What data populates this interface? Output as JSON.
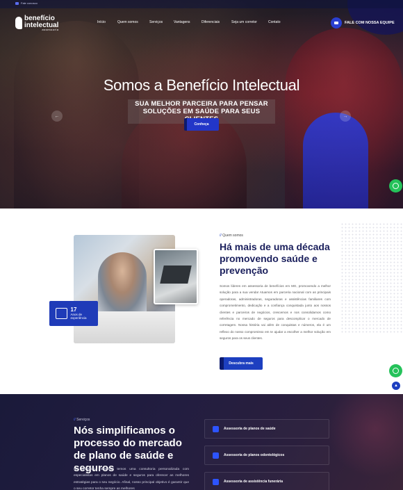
{
  "topbar": {
    "phone_label": "Fale conosco"
  },
  "logo": {
    "line1": "benefício",
    "line2": "intelectual",
    "line3": "assessoria"
  },
  "nav": {
    "items": [
      "Início",
      "Quem somos",
      "Serviços",
      "Vantagens",
      "Diferenciais",
      "Seja um corretor",
      "Contato"
    ],
    "cta": "FALE COM NOSSA EQUIPE"
  },
  "hero": {
    "title": "Somos a Benefício Intelectual",
    "subtitle": "SUA MELHOR PARCEIRA PARA PENSAR SOLUÇÕES EM SAÚDE PARA SEUS CLIENTES",
    "button": "Conheça",
    "prev": "←",
    "next": "→"
  },
  "about": {
    "eyebrow_slash": "//",
    "eyebrow": "Quem somos",
    "title": "Há mais de uma década promovendo saúde e prevenção",
    "text": "Somos líderes em assessoria de benefícios em MG, promovendo a melhor solução para a sua venda! Atuamos em parceria nacional com as principais operadoras, administradoras, seguradoras e assistências familiares com comprometimento, dedicação e a confiança conquistada junto aos nossos clientes e parceiros de negócios, crescemos e nos consolidamos como referência no mercado de seguros para descomplicar o mercado de corretagem. Nossa história vai além de conquistas e números, ela é um reflexo do nosso compromisso em te ajudar a escolher a melhor solução em seguros para os seus clientes.",
    "button": "Descubra mais",
    "badge_number": "17",
    "badge_label": "Anos de experiência"
  },
  "services": {
    "eyebrow_slash": "//",
    "eyebrow": "Serviços",
    "title": "Nós simplificamos o processo do mercado de plano de saúde e seguros",
    "text": "Na Benefício Intelectual temos uma consultoria personalizada com especialistas em planos de saúde e seguros para oferecer as melhores estratégias para o seu negócio. Afinal, nosso principal objetivo é garantir que o seu corretor tenha sempre as melhores",
    "cards": [
      {
        "label": "Assessoria de planos de saúde"
      },
      {
        "label": "Assessoria de planos odontológicos"
      },
      {
        "label": "Assessoria de assistência funerária"
      }
    ]
  },
  "floating": {
    "up": "▲"
  },
  "colors": {
    "brand_blue": "#1d3fc0",
    "navy": "#1a1f5c",
    "whatsapp": "#25c25a"
  },
  "icons": [
    "phone-icon",
    "mail-icon",
    "whatsapp-icon",
    "arrow-up-icon",
    "people-icon",
    "service-icon"
  ]
}
